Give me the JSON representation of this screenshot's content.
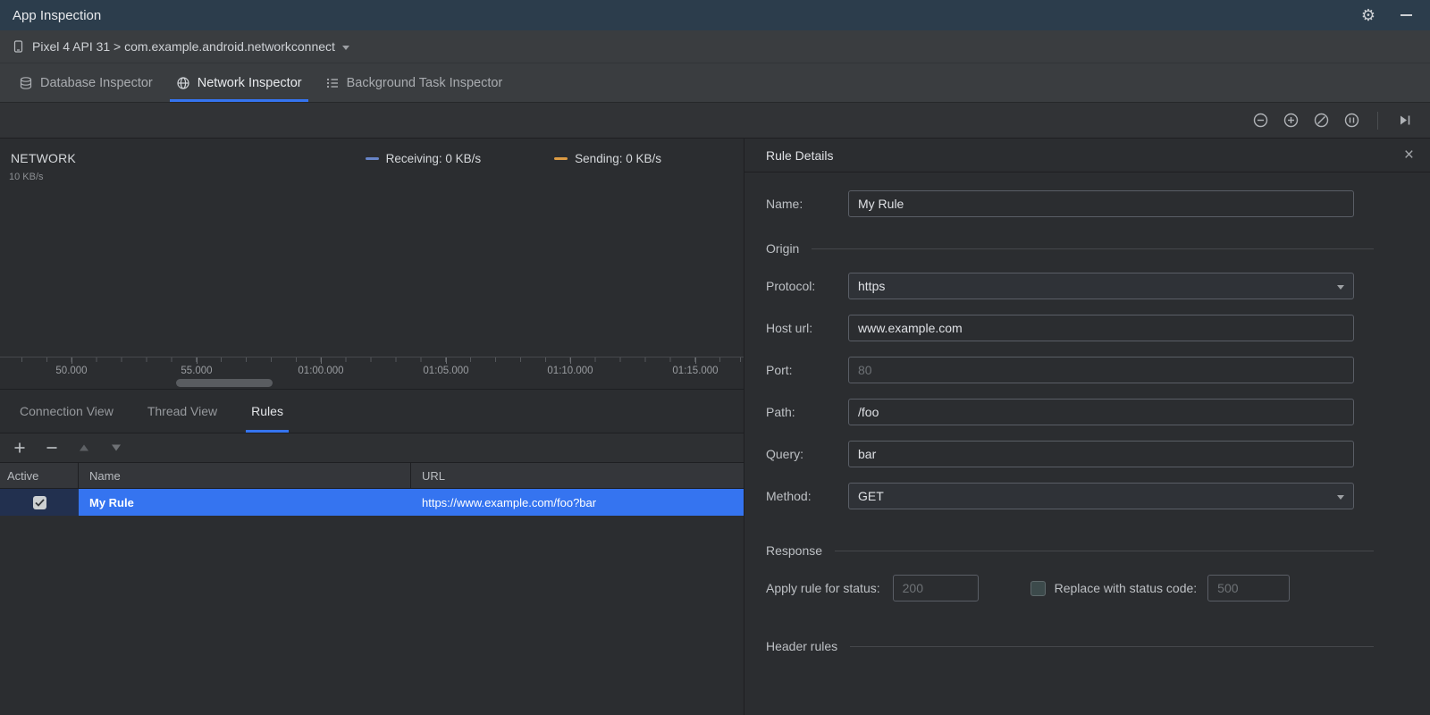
{
  "colors": {
    "accent": "#3574F0",
    "selection": "#3574F0",
    "receiving": "#6784C7",
    "sending": "#DC9B44"
  },
  "icons": {
    "settings": "⚙",
    "close": "×"
  },
  "title_bar": {
    "title": "App Inspection"
  },
  "device_bar": {
    "selector": "Pixel 4 API 31 > com.example.android.networkconnect"
  },
  "inspector_tabs": {
    "items": [
      {
        "label": "Database Inspector",
        "selected": false
      },
      {
        "label": "Network Inspector",
        "selected": true
      },
      {
        "label": "Background Task Inspector",
        "selected": false
      }
    ]
  },
  "timeline_toolbar": {
    "buttons": [
      "zoom-out",
      "zoom-in",
      "reset-zoom",
      "zoom-to-selection",
      "jump-to-live"
    ]
  },
  "chart": {
    "title": "NETWORK",
    "y_top_label": "10 KB/s",
    "legend": [
      {
        "label": "Receiving: 0 KB/s",
        "color": "#6784C7"
      },
      {
        "label": "Sending: 0 KB/s",
        "color": "#DC9B44"
      }
    ],
    "ticks": [
      "50.000",
      "55.000",
      "01:00.000",
      "01:05.000",
      "01:10.000",
      "01:15.000"
    ]
  },
  "chart_data": {
    "type": "line",
    "title": "NETWORK",
    "ylabel": "KB/s",
    "ylim": [
      0,
      10
    ],
    "x_ticks": [
      "50.000",
      "55.000",
      "01:00.000",
      "01:05.000",
      "01:10.000",
      "01:15.000"
    ],
    "series": [
      {
        "name": "Receiving",
        "current_value": "0 KB/s",
        "color": "#6784C7",
        "values": [
          0,
          0,
          0,
          0,
          0,
          0
        ]
      },
      {
        "name": "Sending",
        "current_value": "0 KB/s",
        "color": "#DC9B44",
        "values": [
          0,
          0,
          0,
          0,
          0,
          0
        ]
      }
    ],
    "legend_position": "top"
  },
  "view_tabs": {
    "items": [
      {
        "label": "Connection View",
        "selected": false
      },
      {
        "label": "Thread View",
        "selected": false
      },
      {
        "label": "Rules",
        "selected": true
      }
    ]
  },
  "rules_toolbar": {
    "buttons": [
      "add",
      "remove",
      "move-up",
      "move-down"
    ]
  },
  "rules_table": {
    "columns": [
      "Active",
      "Name",
      "URL"
    ],
    "rows": [
      {
        "active": true,
        "name": "My Rule",
        "url": "https://www.example.com/foo?bar",
        "selected": true
      }
    ]
  },
  "rule_details": {
    "title": "Rule Details",
    "name": {
      "label": "Name:",
      "value": "My Rule"
    },
    "origin_section": "Origin",
    "protocol": {
      "label": "Protocol:",
      "value": "https"
    },
    "host": {
      "label": "Host url:",
      "value": "www.example.com"
    },
    "port": {
      "label": "Port:",
      "placeholder": "80"
    },
    "path": {
      "label": "Path:",
      "value": "/foo"
    },
    "query": {
      "label": "Query:",
      "value": "bar"
    },
    "method": {
      "label": "Method:",
      "value": "GET"
    },
    "response_section": "Response",
    "apply_status": {
      "label": "Apply rule for status:",
      "placeholder": "200"
    },
    "replace_status": {
      "label": "Replace with status code:",
      "placeholder": "500",
      "checked": false
    },
    "header_rules_section": "Header rules"
  }
}
